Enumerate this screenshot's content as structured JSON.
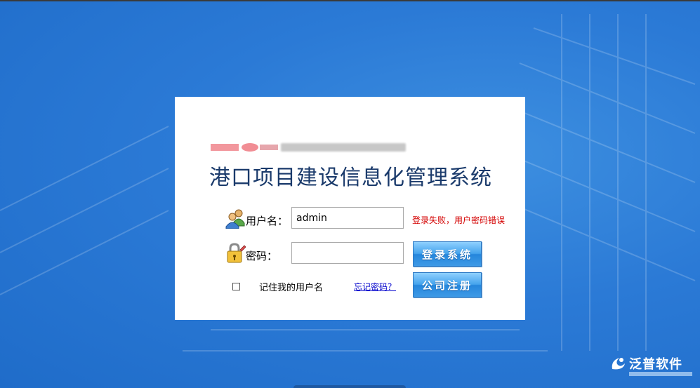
{
  "app": {
    "title": "港口项目建设信息化管理系统"
  },
  "form": {
    "username_label": "用户名：",
    "username_value": "admin",
    "password_label": "密码：",
    "password_value": "",
    "error_message": "登录失败，用户密码错误",
    "login_button": "登录系统",
    "register_button": "公司注册",
    "remember_label": "记住我的用户名",
    "remember_checked": false,
    "forgot_link": "忘记密码？"
  },
  "branding": {
    "footer_name": "泛普软件"
  },
  "colors": {
    "background": "#2b7ad6",
    "title": "#1a3a6b",
    "error": "#d40000",
    "button": "#3e9ae6",
    "link": "#0000cc"
  },
  "icons": {
    "username": "users-icon",
    "password": "lock-pencil-icon",
    "logo": "company-logo",
    "footer": "fanpu-logo-icon"
  }
}
